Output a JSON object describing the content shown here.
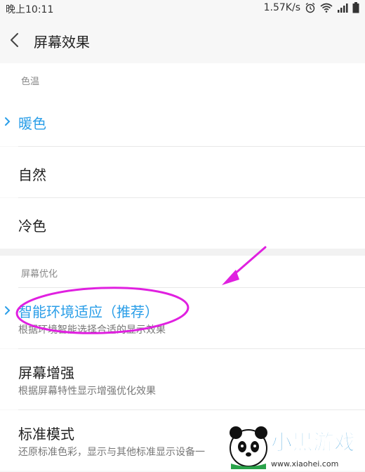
{
  "status_bar": {
    "time": "晚上10:11",
    "network_speed": "1.57K/s",
    "icons": [
      "alarm-icon",
      "wifi-icon",
      "signal-icon",
      "battery-icon"
    ]
  },
  "header": {
    "back_icon": "chevron-left",
    "title": "屏幕效果"
  },
  "sections": {
    "color_temp": {
      "title": "色温",
      "options": [
        {
          "label": "暖色",
          "selected": true
        },
        {
          "label": "自然",
          "selected": false
        },
        {
          "label": "冷色",
          "selected": false
        }
      ]
    },
    "screen_opt": {
      "title": "屏幕优化",
      "options": [
        {
          "label": "智能环境适应（推荐）",
          "desc": "根据环境智能选择合适的显示效果",
          "selected": true
        },
        {
          "label": "屏幕增强",
          "desc": "根据屏幕特性显示增强优化效果",
          "selected": false
        },
        {
          "label": "标准模式",
          "desc": "还原标准色彩，显示与其他标准显示设备一",
          "selected": false
        }
      ]
    }
  },
  "colors": {
    "accent": "#2a9ee8",
    "annotation": "#e020e0"
  },
  "watermark": {
    "text": "小黑游戏",
    "url": "www.xiaohei.com"
  }
}
